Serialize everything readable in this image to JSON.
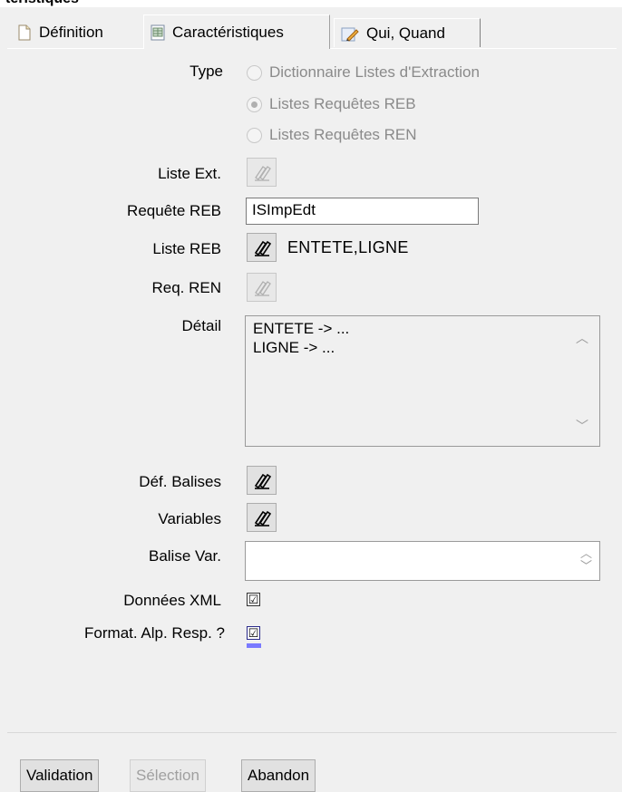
{
  "window": {
    "title_fragment": "téristiques"
  },
  "tabs": [
    {
      "label": "Définition",
      "icon": "page-icon"
    },
    {
      "label": "Caractéristiques",
      "icon": "grid-document-icon",
      "active": true
    },
    {
      "label": "Qui, Quand",
      "icon": "pencil-icon"
    }
  ],
  "form": {
    "type_label": "Type",
    "type_options": [
      {
        "label": "Dictionnaire Listes d'Extraction",
        "selected": false
      },
      {
        "label": "Listes Requêtes REB",
        "selected": true
      },
      {
        "label": "Listes Requêtes REN",
        "selected": false
      }
    ],
    "liste_ext_label": "Liste Ext.",
    "requete_reb_label": "Requête REB",
    "requete_reb_value": "ISImpEdt",
    "liste_reb_label": "Liste REB",
    "liste_reb_value": "ENTETE,LIGNE",
    "req_ren_label": "Req. REN",
    "detail_label": "Détail",
    "detail_lines": [
      "ENTETE -> ...",
      "LIGNE -> ..."
    ],
    "def_balises_label": "Déf. Balises",
    "variables_label": "Variables",
    "balise_var_label": "Balise Var.",
    "balise_var_value": "",
    "donnees_xml_label": "Données XML",
    "donnees_xml_checked": true,
    "format_alp_label": "Format. Alp. Resp. ?",
    "format_alp_checked": true,
    "check_glyph": "☑"
  },
  "buttons": {
    "validation": "Validation",
    "selection": "Sélection",
    "abandon": "Abandon"
  },
  "colors": {
    "focus": "#7a7aff",
    "disabled_text": "#8a8a8a"
  }
}
